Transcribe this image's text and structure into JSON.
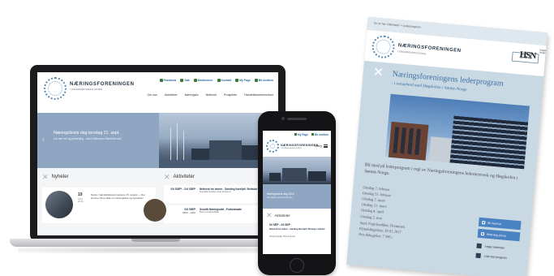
{
  "laptop": {
    "brand": "NÆRINGSFORENINGEN",
    "brand_sub": "I DRAMMENSREGIONEN",
    "util": [
      {
        "label": "Facebook"
      },
      {
        "label": "Søk"
      },
      {
        "label": "Medlemmer"
      },
      {
        "label": "Kontakt"
      },
      {
        "label": "My Page"
      },
      {
        "label": "Bli medlem"
      }
    ],
    "nav": [
      "Om oss",
      "Aktiviteter",
      "Næringsliv",
      "Nettverk",
      "Prosjekter",
      "Handelsbestemmelser"
    ],
    "hero_title": "Næringslivets dag torsdag 21. sept.",
    "hero_sub": "Les mer her og påmelding - Hans Willumsen Stenfeldt med",
    "news_heading": "Nyheter",
    "activities_heading": "Aktiviteter",
    "news": {
      "day": "19",
      "month": "AUG",
      "year": "2016",
      "text": "Neste / Handelsbestemmelsene 15. august — Det kommer flere tiltak om næringslivet og styreleder"
    },
    "events": [
      {
        "date": "03 SEP - 04 SEP",
        "time": "",
        "title": "Nettverk for ledere - Samling Norefjell 'Nettside'",
        "sub": "Norefjell Quality Hotel & Resort"
      },
      {
        "date": "03 SEP",
        "time": "0800 - 1000",
        "title": "Svovlik Næringsråd - Frokostmøte",
        "sub": "Berit Gundersdatter"
      }
    ]
  },
  "phone": {
    "util": [
      {
        "label": "My Page"
      },
      {
        "label": "Bli medlem"
      }
    ],
    "brand": "NÆRINGSFORENINGEN",
    "brand_sub": "I DRAMMENSREGIONEN",
    "menu": "Meny",
    "blue_title": "Næringslivets dag 2016",
    "blue_sub": "Se program og påmelding her",
    "activities_heading": "Aktiviteter",
    "event_date": "03 SEP - 04 SEP",
    "event_title": "Nettverk for ledere - Samling Norefjell 'Strategi i ledelse'",
    "event_sub": "Norefjell Quality Hotel & Resort"
  },
  "flyer": {
    "breadcrumb": "Du er her: Aktiviteter > Lederprogram",
    "brand": "NÆRINGSFORENINGEN",
    "brand_sub": "I DRAMMENSREGIONEN",
    "top_button": "Bestill nå",
    "hsn_mark": "HSN",
    "hsn_text": "Høgskolen i Sørøst-Norge",
    "title": "Næringsforeningens lederprogram",
    "subtitle": "- i samarbeid med Høgskolen i Sørøst-Norge",
    "intro": "Bli med på lederprogram i regi av Næringsforeningens ledernettverk og Høgskolen i Sørøst-Norge.",
    "dates": [
      "Onsdag 7. februar",
      "Onsdag 21. februar",
      "Onsdag 7. mars",
      "Onsdag 21. mars",
      "Onsdag 4. april",
      "Onsdag 2. mai"
    ],
    "place": [
      "Sted: Papirbredden, Drammen",
      "Påmeldingsfrist: 30.01.2017",
      "Pris deltagelse: 7 500,-"
    ],
    "buttons": [
      "Bli med her",
      "Meld deg på her"
    ],
    "links": [
      "Legg i kalender",
      "Last ned program"
    ]
  }
}
